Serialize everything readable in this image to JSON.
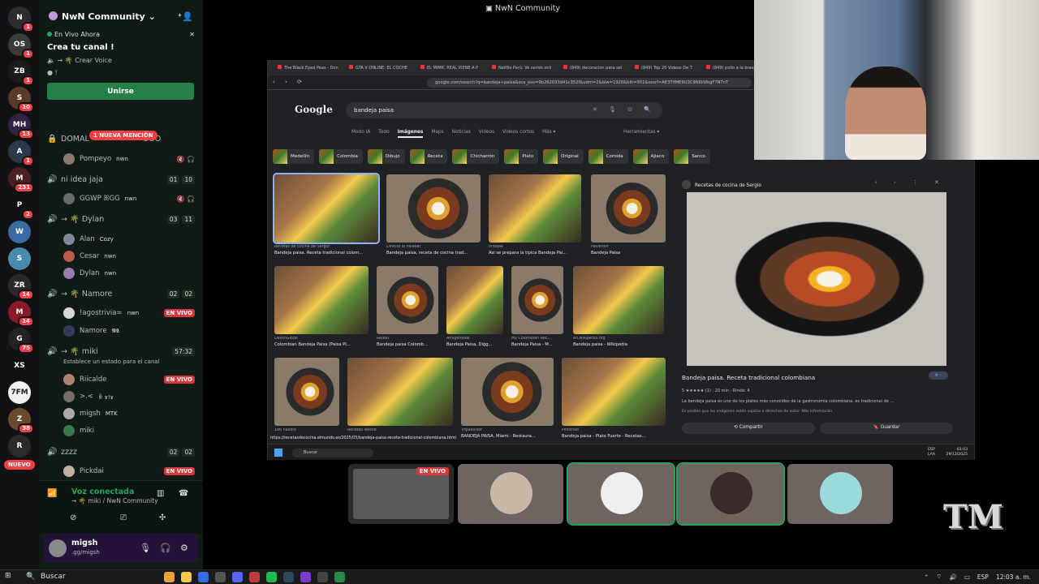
{
  "stage": {
    "title": "NwN Community"
  },
  "server": {
    "name": "NwN Community",
    "rail": [
      {
        "label": "N",
        "badge": "1",
        "color": "#2b2d31"
      },
      {
        "label": "OS",
        "badge": "1",
        "color": "#3b3b3b"
      },
      {
        "label": "ZB",
        "badge": "1",
        "color": "#1b1b1b"
      },
      {
        "label": "S",
        "badge": "10",
        "color": "#5a3a2a"
      },
      {
        "label": "MH",
        "badge": "13",
        "color": "#332244"
      },
      {
        "label": "A",
        "badge": "1",
        "color": "#2a3a4a"
      },
      {
        "label": "M",
        "badge": "231",
        "color": "#4a2020"
      },
      {
        "label": "P",
        "badge": "2",
        "color": "#111111"
      },
      {
        "label": "W",
        "badge": "",
        "color": "#3a6aa0"
      },
      {
        "label": "S",
        "badge": "",
        "color": "#4a8ab0"
      },
      {
        "label": "ZR",
        "badge": "14",
        "color": "#2a2a2a"
      },
      {
        "label": "M",
        "badge": "14",
        "color": "#8a1a2a"
      },
      {
        "label": "G",
        "badge": "75",
        "color": "#222222"
      },
      {
        "label": "XS",
        "badge": "",
        "color": "#111111"
      },
      {
        "label": "7FM",
        "badge": "",
        "color": "#f2f2f2"
      },
      {
        "label": "Z",
        "badge": "38",
        "color": "#6a4a2a"
      },
      {
        "label": "R",
        "badge": "",
        "color": "#2a2a2a"
      }
    ],
    "new_label": "NUEVO"
  },
  "live_card": {
    "status": "En Vivo Ahora",
    "title": "Crea tu canal !",
    "sub": "→ 🌴 Crear Voice",
    "sub2": "!",
    "join": "Unirse"
  },
  "mention_badge": "1 NUEVA MENCIÓN",
  "channels": [
    {
      "name": "DOMAL",
      "tail": "OOO",
      "nums": [],
      "icon": "lock"
    },
    {
      "name": "ni idea jaja",
      "nums": [
        "01",
        "10"
      ],
      "icon": "speaker"
    },
    {
      "name": "→ 🌴 Dylan",
      "nums": [
        "03",
        "11"
      ],
      "icon": "speaker"
    },
    {
      "name": "→ 🌴 Namore",
      "nums": [
        "02",
        "02"
      ],
      "icon": "speaker"
    },
    {
      "name": "→ 🌴 miki",
      "nums": [
        "57:32"
      ],
      "icon": "speaker",
      "status": "Establece un estado para el canal"
    },
    {
      "name": "zzzz",
      "nums": [
        "02",
        "02"
      ],
      "icon": "speaker"
    }
  ],
  "users": [
    {
      "name": "Pompeyo",
      "tag": "nwn",
      "live": "",
      "color": "#8a7a6a"
    },
    {
      "name": "GGWP ꕤGG",
      "tag": "nwn",
      "live": "",
      "color": "#6a6a6a"
    },
    {
      "name": "Alan",
      "tag": "Cozy",
      "live": "",
      "color": "#7a8a9a"
    },
    {
      "name": "Cesar",
      "tag": "nwn",
      "live": "",
      "color": "#c05a4a"
    },
    {
      "name": "Dylan",
      "tag": "nwn",
      "live": "",
      "color": "#9a7ab0"
    },
    {
      "name": "!agostrivia=",
      "tag": "nwn",
      "live": "EN VIVO",
      "color": "#d8d8d8"
    },
    {
      "name": "Namore",
      "tag": "𝕹𝕮",
      "live": "",
      "color": "#3a3a5a"
    },
    {
      "name": "Riicalde",
      "tag": "",
      "live": "EN VIVO",
      "color": "#b08070"
    },
    {
      "name": ">.<",
      "tag": "ꆜ ɤ!ɤ",
      "live": "",
      "color": "#7a6a6a"
    },
    {
      "name": "migsh",
      "tag": "MTK",
      "live": "",
      "color": "#aaaaaa"
    },
    {
      "name": "miki",
      "tag": "",
      "live": "",
      "color": "#3a7a4a"
    },
    {
      "name": "Pickdai",
      "tag": "",
      "live": "EN VIVO",
      "color": "#c0b0a0"
    }
  ],
  "voice": {
    "status": "Voz conectada",
    "location": "→ 🌴 miki / NwN Community"
  },
  "account": {
    "name": "migsh",
    "status": ".gg/migsh"
  },
  "browser": {
    "tabs": [
      "The Black Eyed Peas - Don",
      "GTA V ONLINE: EL COCHE",
      "EL MIMIC REAL VIENE A P",
      "Netflix Perú: Ve series onli",
      "(849) decoracion para sel",
      "(849) Top 20 Videos De T",
      "(849) pollo a la brasa per"
    ],
    "url": "google.com/search?q=bandeja+paisa&sca_esv=9b262033d41c352f&udm=2&biw=1920&bih=951&sxsrf=AE3TifME9U3C9N6tWkgF7NTnT"
  },
  "google": {
    "logo": "Google",
    "query": "bandeja paisa",
    "nav": [
      "Modo IA",
      "Todo",
      "Imágenes",
      "Maps",
      "Noticias",
      "Videos",
      "Videos cortos",
      "Más ▾"
    ],
    "active_nav": "Imágenes",
    "tools": "Herramientas ▾",
    "chips": [
      "Medellín",
      "Colombia",
      "Dibujo",
      "Receta",
      "Chicharrón",
      "Plato",
      "Original",
      "Comida",
      "Ajiaco",
      "Sanco"
    ]
  },
  "results": [
    {
      "src": "Recetas de cocina de Sergio",
      "cap": "Bandeja paisa. Receta tradicional colom...",
      "sel": true
    },
    {
      "src": "Directo al Paladar",
      "cap": "Bandeja paisa, receta de cocina trad..."
    },
    {
      "src": "Infobae",
      "cap": "Así se prepara la típica Bandeja Pai..."
    },
    {
      "src": "Pavlimon",
      "cap": "Bandeja Paisa"
    },
    {
      "src": "DelishGlobe",
      "cap": "Colombian Bandeja Paisa (Paisa Pl..."
    },
    {
      "src": "Reddit",
      "cap": "Bandeja paisa Colomb..."
    },
    {
      "src": "Amigofoods",
      "cap": "Bandeja Paisa, Digg..."
    },
    {
      "src": "My Colombian Rec...",
      "cap": "Bandeja Paisa - M..."
    },
    {
      "src": "en.wikipedia.org",
      "cap": "Bandeja paisa - Wikipedia"
    },
    {
      "src": "196 flavors",
      "cap": ""
    },
    {
      "src": "Recetas Nestlé",
      "cap": ""
    },
    {
      "src": "Tripadvisor",
      "cap": "BANDEJA PAISA, Miami - Restaura..."
    },
    {
      "src": "Pinterest",
      "cap": "Bandeja paisa - Plato Fuerte - Recetas..."
    }
  ],
  "preview": {
    "source": "Recetas de cocina de Sergio",
    "title": "Bandeja paisa. Receta tradicional colombiana",
    "meta": "5 ★★★★★ (1)  ·  20 min  ·  Rinde: 4",
    "desc": "La bandeja paisa es uno de los platos más conocidos de la gastronomía colombiana, es tradicional de ...",
    "note": "Es posible que las imágenes estén sujetas a derechos de autor. Más información",
    "visit": "Ir ›",
    "share": "Compartir",
    "save": "Guardar"
  },
  "status_url": "https://recetasdecocina.elmundo.es/2025/05/bandeja-paisa-receta-tradicional-colombiana.html",
  "win_inner": {
    "search": "Buscar",
    "lang": "ESP\nLAA",
    "time": "03:03\n29/12/2025"
  },
  "participants": [
    {
      "live": "EN VIVO",
      "color": "#5a5a5a",
      "speaking": false
    },
    {
      "live": "",
      "color": "#c8b8a8",
      "speaking": false
    },
    {
      "live": "",
      "color": "#eeeeee",
      "speaking": true
    },
    {
      "live": "",
      "color": "#3a2a2a",
      "speaking": true
    },
    {
      "live": "",
      "color": "#9adada",
      "speaking": false
    }
  ],
  "watermark": "TM",
  "taskbar": {
    "search": "Buscar",
    "lang": "ESP",
    "time": "12:03 a. m."
  }
}
